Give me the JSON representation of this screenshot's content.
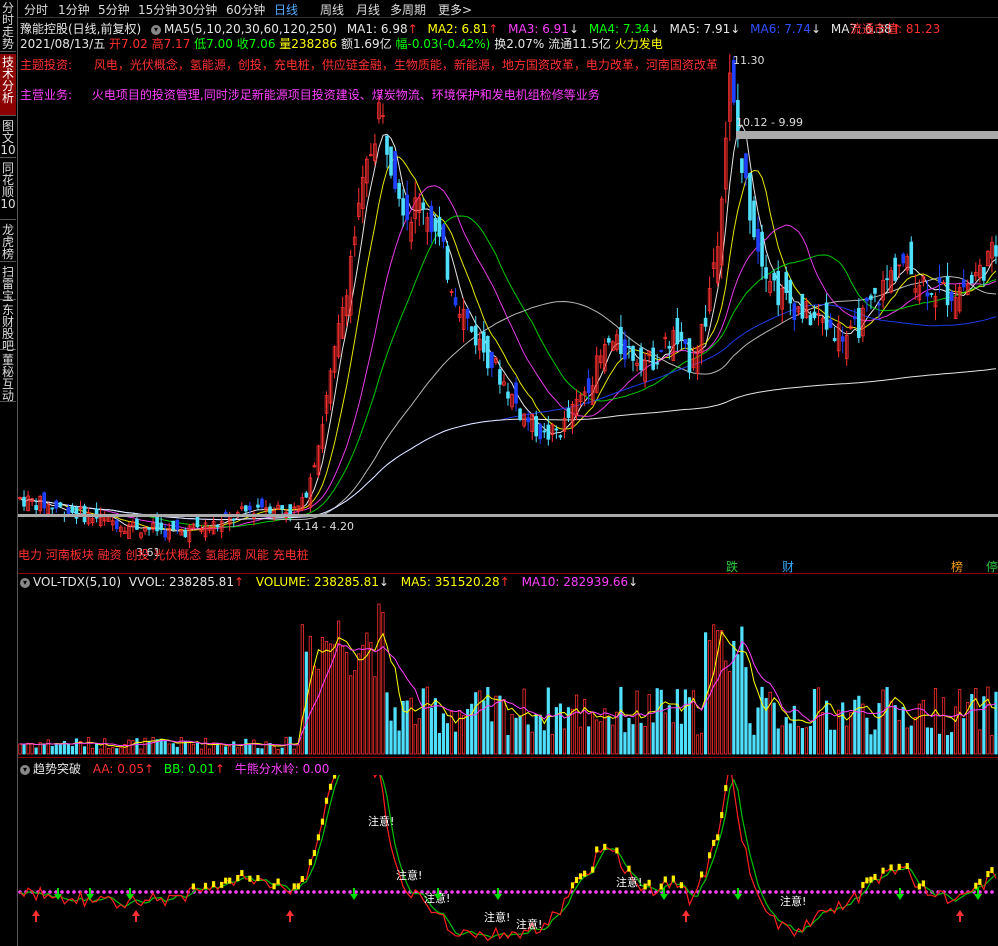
{
  "sidebar": [
    {
      "label": "分时走势",
      "active": false
    },
    {
      "label": "技术分析",
      "active": true
    },
    {
      "label": "图文10",
      "active": false
    },
    {
      "label": "同花顺10",
      "active": false
    },
    {
      "label": "龙虎榜",
      "active": false
    },
    {
      "label": "扫雷宝",
      "active": false
    },
    {
      "label": "东财股吧",
      "active": false
    },
    {
      "label": "董秘互动",
      "active": false
    }
  ],
  "periods": [
    "分时",
    "1分钟",
    "5分钟",
    "15分钟",
    "30分钟",
    "60分钟",
    "日线",
    "周线",
    "月线",
    "多周期",
    "更多>"
  ],
  "active_period": "日线",
  "main": {
    "stock_title": "豫能控股(日线,前复权)",
    "ma_params": "MA5(5,10,20,30,60,120,250)",
    "ma1": "MA1: 6.98",
    "ma2": "MA2: 6.81",
    "ma3": "MA3: 6.91",
    "ma4": "MA4: 7.34",
    "ma5": "MA5: 7.91",
    "ma6": "MA6: 7.74",
    "ma7": "MA7: 6.38",
    "market_cap": "流通市值: 81.23",
    "date": "2021/08/13/五",
    "open": "开7.02",
    "high": "高7.17",
    "low": "低7.00",
    "close": "收7.06",
    "volume": "量238286",
    "amount": "额1.69亿",
    "change": "幅-0.03(-0.42%)",
    "turnover": "换2.07%",
    "float_shares": "流通11.5亿",
    "concept_tag": "火力发电",
    "theme_label": "主题投资:",
    "theme_text": "风电，光伏概念，氢能源，创投，充电桩，供应链金融，生物质能，新能源，地方国资改革，电力改革，河南国资改革",
    "business_label": "主营业务:",
    "business_text": "火电项目的投资管理,同时涉足新能源项目投资建设、煤炭物流、环境保护和发电机组检修等业务",
    "high_mark": "11.30",
    "range_upper": "10.12 - 9.99",
    "range_lower": "4.14 - 4.20",
    "low_mark": "3.61",
    "bottom_tags": "电力 河南板块 融资 创投 光伏概念 氢能源 风能 充电桩",
    "badges": [
      {
        "text": "跌",
        "color": "#2ecc40"
      },
      {
        "text": "财",
        "color": "#3af"
      },
      {
        "text": "榜",
        "color": "#f39c12"
      },
      {
        "text": "停",
        "color": "#2ecc40"
      }
    ]
  },
  "volume_panel": {
    "title": "VOL-TDX(5,10)",
    "vvol": "VVOL: 238285.81",
    "volume": "VOLUME: 238285.81",
    "ma5": "MA5: 351520.28",
    "ma10": "MA10: 282939.66"
  },
  "trend_panel": {
    "title": "趋势突破",
    "aa": "AA: 0.05",
    "bb": "BB: 0.01",
    "water": "牛熊分水岭: 0.00",
    "alert": "注意!"
  },
  "colors": {
    "up": "#ff3030",
    "down_cyan": "#50e0ff",
    "down_blue": "#2040ff",
    "ma_white": "#ffffff",
    "ma_yellow": "#ffff00",
    "ma_magenta": "#ff40ff",
    "ma_green": "#00e000",
    "ma_blue": "#2040ff",
    "separator": "#8b0000"
  }
}
